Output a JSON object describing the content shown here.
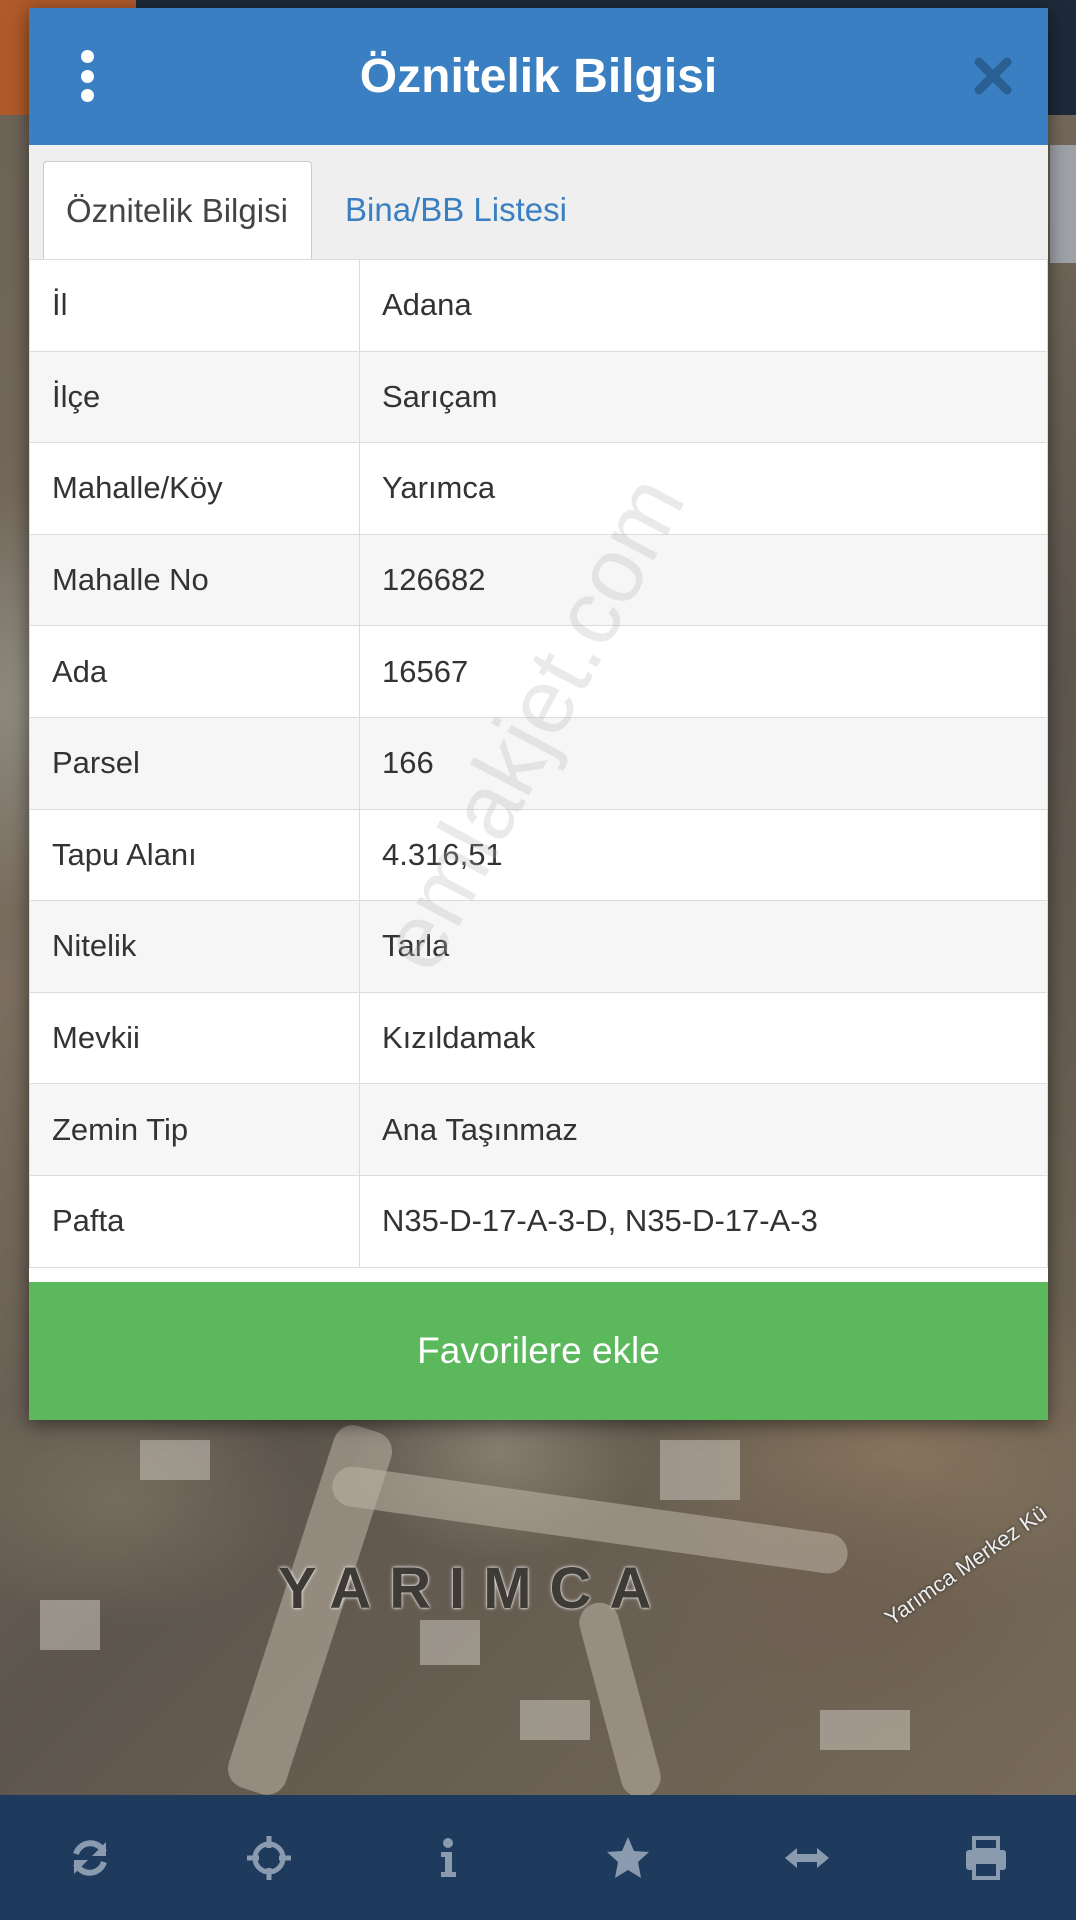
{
  "dialog": {
    "title": "Öznitelik Bilgisi",
    "tabs": [
      {
        "label": "Öznitelik Bilgisi",
        "active": true
      },
      {
        "label": "Bina/BB Listesi",
        "active": false
      }
    ],
    "rows": [
      {
        "key": "İl",
        "value": "Adana"
      },
      {
        "key": "İlçe",
        "value": "Sarıçam"
      },
      {
        "key": "Mahalle/Köy",
        "value": "Yarımca"
      },
      {
        "key": "Mahalle No",
        "value": "126682"
      },
      {
        "key": "Ada",
        "value": "16567"
      },
      {
        "key": "Parsel",
        "value": "166"
      },
      {
        "key": "Tapu Alanı",
        "value": "4.316,51"
      },
      {
        "key": "Nitelik",
        "value": "Tarla"
      },
      {
        "key": "Mevkii",
        "value": "Kızıldamak"
      },
      {
        "key": "Zemin Tip",
        "value": "Ana Taşınmaz"
      },
      {
        "key": "Pafta",
        "value": "N35-D-17-A-3-D, N35-D-17-A-3"
      }
    ],
    "favorite_label": "Favorilere ekle",
    "watermark": "emlakjet.com"
  },
  "map": {
    "place_label": "YARIMCA",
    "road_label": "Yarımca Merkez Kü"
  },
  "toolbar": {
    "icons": [
      "refresh-icon",
      "crosshair-icon",
      "info-icon",
      "star-icon",
      "arrows-horizontal-icon",
      "print-icon"
    ]
  },
  "colors": {
    "header": "#3a7fc1",
    "favorite": "#5cb85c",
    "toolbar": "#1e3a5c"
  }
}
